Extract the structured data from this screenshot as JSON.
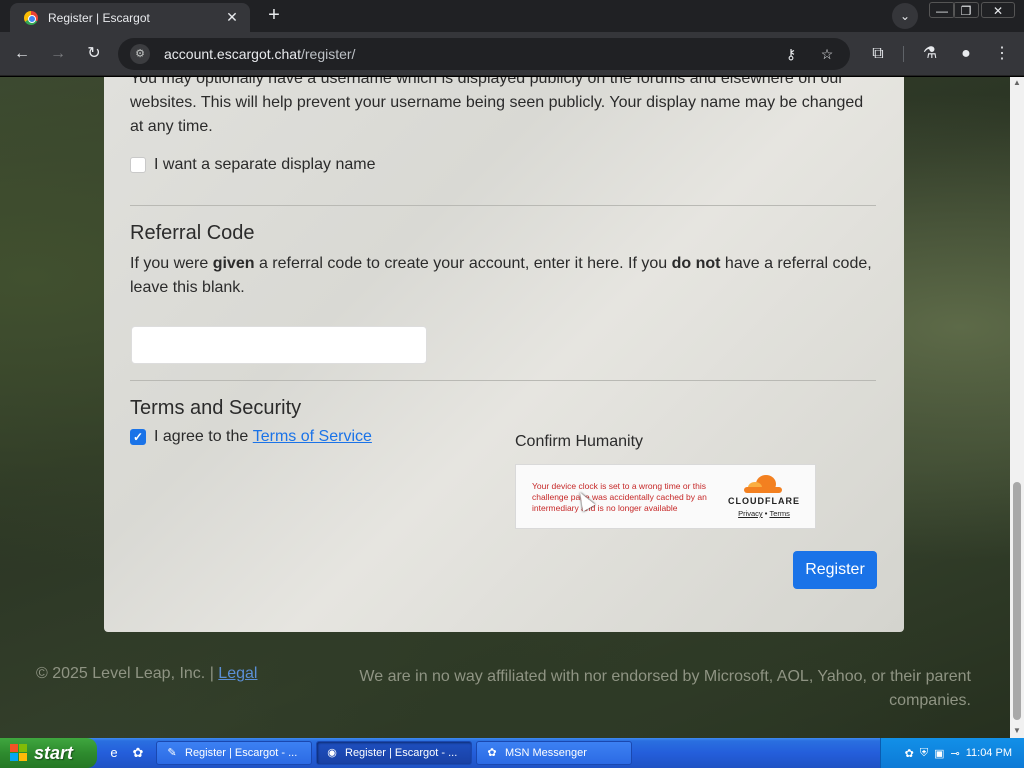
{
  "browser": {
    "tab_title": "Register | Escargot",
    "tab_close": "✕",
    "new_tab": "+",
    "url_host": "account.escargot.chat",
    "url_path": "/register/",
    "window_controls": [
      "—",
      "❐",
      "✕"
    ]
  },
  "form": {
    "display_name_desc": "You may optionally have a username which is displayed publicly on the forums and elsewhere on our websites. This will help prevent your username being seen publicly. Your display name may be changed at any time.",
    "display_name_checkbox": "I want a separate display name",
    "display_name_checked": false,
    "referral_heading": "Referral Code",
    "referral_desc_1": "If you were ",
    "referral_desc_bold_1": "given",
    "referral_desc_2": " a referral code to create your account, enter it here. If you ",
    "referral_desc_bold_2": "do not",
    "referral_desc_3": " have a referral code, leave this blank.",
    "referral_value": "",
    "terms_heading": "Terms and Security",
    "terms_prefix": "I agree to the ",
    "terms_link": "Terms of Service",
    "terms_checked": true,
    "confirm_label": "Confirm Humanity",
    "turnstile_error": "Your device clock is set to a wrong time or this challenge page was accidentally cached by an intermediary and is no longer available",
    "cloudflare_word": "CLOUDFLARE",
    "cf_privacy": "Privacy",
    "cf_sep": " • ",
    "cf_terms": "Terms",
    "register_button": "Register"
  },
  "footer": {
    "copyright": "© 2025 Level Leap, Inc. | ",
    "legal_link": "Legal",
    "disclaimer": "We are in no way affiliated with nor endorsed by Microsoft, AOL, Yahoo, or their parent companies."
  },
  "taskbar": {
    "start_label": "start",
    "buttons": [
      {
        "label": "Register | Escargot - ...",
        "icon": "paint-icon",
        "active": false
      },
      {
        "label": "Register | Escargot - ...",
        "icon": "chrome-icon",
        "active": true
      },
      {
        "label": "MSN Messenger",
        "icon": "msn-icon",
        "active": false
      }
    ],
    "clock": "11:04 PM"
  },
  "colors": {
    "accent": "#1a73e8",
    "taskbar_blue": "#245edb",
    "start_green": "#2e8b2e",
    "error_red": "#c62828"
  }
}
